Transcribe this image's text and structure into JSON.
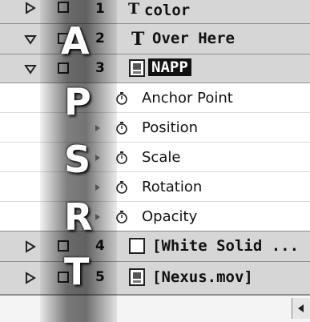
{
  "layers": [
    {
      "num": "1",
      "name": "color",
      "type_glyph": "T",
      "expanded": false,
      "partial": true
    },
    {
      "num": "2",
      "name": "Over Here",
      "type_glyph": "T",
      "expanded": true
    },
    {
      "num": "3",
      "name": "NAPP",
      "expanded": true,
      "selected": true
    },
    {
      "num": "4",
      "name": "[White Solid ..."
    },
    {
      "num": "5",
      "name": "[Nexus.mov]"
    }
  ],
  "properties": [
    {
      "name": "Anchor Point"
    },
    {
      "name": "Position"
    },
    {
      "name": "Scale"
    },
    {
      "name": "Rotation"
    },
    {
      "name": "Opacity"
    }
  ],
  "shortcuts": [
    "A",
    "P",
    "S",
    "R",
    "T"
  ],
  "colors": {
    "row_bg": "#d6d6d6",
    "selected_bg": "#111111",
    "selected_text": "#ffffff"
  }
}
